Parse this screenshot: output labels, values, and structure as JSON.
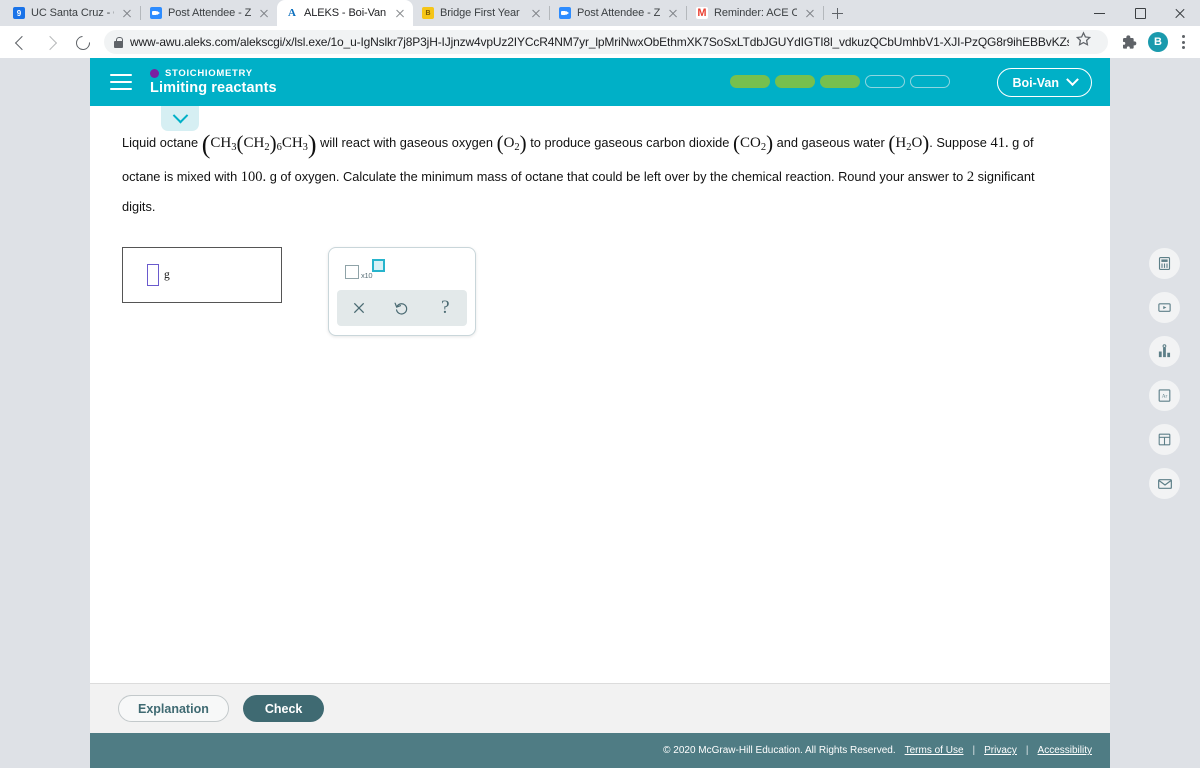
{
  "browser": {
    "tabs": [
      {
        "title": "UC Santa Cruz - Calendar - …",
        "favicon": "calendar-icon",
        "active": false
      },
      {
        "title": "Post Attendee - Zoom",
        "favicon": "zoom-icon",
        "active": false
      },
      {
        "title": "ALEKS - Boi-Van Nguyen - L…",
        "favicon": "aleks-icon",
        "active": true
      },
      {
        "title": "Bridge First Year Experience",
        "favicon": "bridge-icon",
        "active": false
      },
      {
        "title": "Post Attendee - Zoom",
        "favicon": "zoom-icon",
        "active": false
      },
      {
        "title": "Reminder: ACE Orientation T…",
        "favicon": "gmail-icon",
        "active": false
      }
    ],
    "new_tab_label": "+",
    "url": "www-awu.aleks.com/alekscgi/x/lsl.exe/1o_u-IgNslkr7j8P3jH-IJjnzw4vpUz2IYCcR4NM7yr_lpMriNwxObEthmXK7SoSxLTdbJGUYdIGTI8l_vdkuzQCbUmhbV1-XJI-PzQG8r9ihEBBvKZs?1oBw7QYjlbavbSPX…",
    "profile_initial": "B"
  },
  "header": {
    "topic": "STOICHIOMETRY",
    "objective": "Limiting reactants",
    "topic_dot_color": "#7b1fa2",
    "bar_color": "#00b0c7",
    "progress": {
      "total": 5,
      "filled": 3,
      "fill_color": "#76c04e"
    },
    "user_name": "Boi-Van"
  },
  "question": {
    "line1_a": "Liquid octane",
    "formula_octane": {
      "c1": "CH",
      "s1": "3",
      "c2": "CH",
      "s2": "2",
      "sub_outer": "6",
      "c3": "CH",
      "s3": "3"
    },
    "line1_b": "will react with gaseous oxygen",
    "formula_oxygen": {
      "c": "O",
      "s": "2"
    },
    "line1_c": "to produce gaseous carbon dioxide",
    "formula_co2": {
      "c": "CO",
      "s": "2"
    },
    "line1_d": "and gaseous water",
    "formula_water": {
      "c1": "H",
      "s1": "2",
      "c2": "O"
    },
    "line1_e": ". Suppose",
    "mass_octane": "41.",
    "line1_f": "g of",
    "line2_a": "octane is mixed with",
    "mass_oxygen": "100.",
    "line2_b": "g of oxygen. Calculate the minimum mass of octane that could be left over by the chemical reaction. Round your answer to",
    "sig_figs": "2",
    "line3": "significant digits."
  },
  "answer": {
    "value": "",
    "unit": "g"
  },
  "palette": {
    "scientific_notation_label": "x10",
    "buttons": [
      {
        "name": "clear",
        "glyph": "✕"
      },
      {
        "name": "undo",
        "glyph": "↺"
      },
      {
        "name": "help",
        "glyph": "?"
      }
    ]
  },
  "tool_rail": [
    {
      "name": "calculator-icon"
    },
    {
      "name": "video-icon"
    },
    {
      "name": "chart-icon"
    },
    {
      "name": "periodic-table-icon",
      "label": "Ar"
    },
    {
      "name": "reference-table-icon"
    },
    {
      "name": "message-icon"
    }
  ],
  "actions": {
    "explanation_label": "Explanation",
    "check_label": "Check"
  },
  "footer": {
    "copyright": "© 2020 McGraw-Hill Education. All Rights Reserved.",
    "links": [
      "Terms of Use",
      "Privacy",
      "Accessibility"
    ],
    "separator": "|"
  }
}
